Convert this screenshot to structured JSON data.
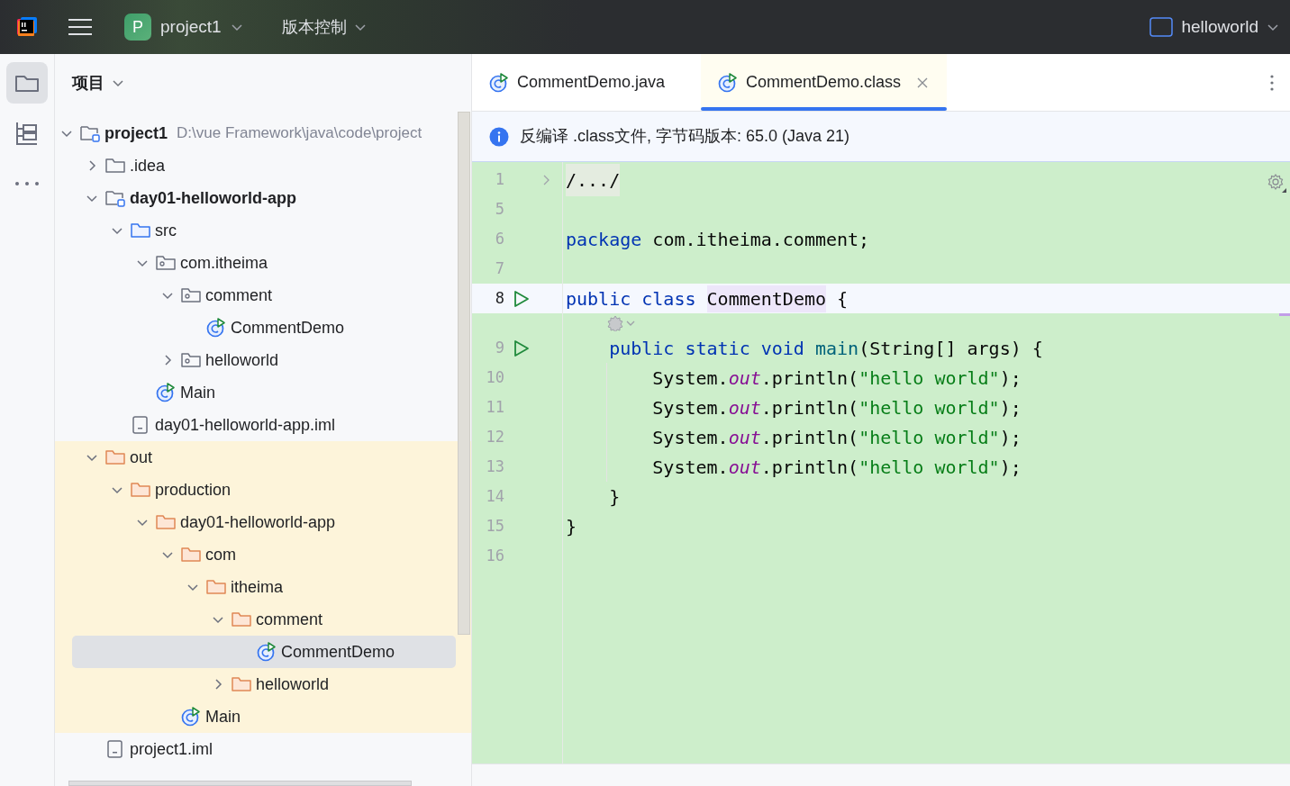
{
  "title_bar": {
    "project_badge": "P",
    "project": "project1",
    "vcs": "版本控制",
    "run_config": "helloworld"
  },
  "tool_strip": [
    {
      "kind": "project",
      "selected": true
    },
    {
      "kind": "structure",
      "selected": false
    },
    {
      "kind": "more",
      "selected": false
    }
  ],
  "project_panel": {
    "title": "项目",
    "tree": [
      {
        "label": "project1",
        "detail": "D:\\vue Framework\\java\\code\\project",
        "kind": "module",
        "expanded": true,
        "selected": false,
        "children": [
          {
            "label": ".idea",
            "kind": "folder",
            "expanded": false,
            "selected": false
          },
          {
            "label": "day01-helloworld-app",
            "kind": "module",
            "expanded": true,
            "selected": false,
            "children": [
              {
                "label": "src",
                "kind": "source-folder",
                "expanded": true,
                "selected": false,
                "children": [
                  {
                    "label": "com.itheima",
                    "kind": "package",
                    "expanded": true,
                    "selected": false,
                    "children": [
                      {
                        "label": "comment",
                        "kind": "package",
                        "expanded": true,
                        "selected": false,
                        "children": [
                          {
                            "label": "CommentDemo",
                            "kind": "class",
                            "selected": false
                          }
                        ]
                      },
                      {
                        "label": "helloworld",
                        "kind": "package",
                        "expanded": false,
                        "selected": false
                      }
                    ]
                  },
                  {
                    "label": "Main",
                    "kind": "class",
                    "selected": false
                  }
                ]
              },
              {
                "label": "day01-helloworld-app.iml",
                "kind": "file",
                "selected": false
              }
            ]
          },
          {
            "label": "out",
            "kind": "output-folder",
            "expanded": true,
            "selected": false,
            "children": [
              {
                "label": "production",
                "kind": "output-folder",
                "expanded": true,
                "selected": false,
                "children": [
                  {
                    "label": "day01-helloworld-app",
                    "kind": "output-folder",
                    "expanded": true,
                    "selected": false,
                    "children": [
                      {
                        "label": "com",
                        "kind": "output-folder",
                        "expanded": true,
                        "selected": false,
                        "children": [
                          {
                            "label": "itheima",
                            "kind": "output-folder",
                            "expanded": true,
                            "selected": false,
                            "children": [
                              {
                                "label": "comment",
                                "kind": "output-folder",
                                "expanded": true,
                                "selected": false,
                                "children": [
                                  {
                                    "label": "CommentDemo",
                                    "kind": "class",
                                    "selected": true
                                  }
                                ]
                              },
                              {
                                "label": "helloworld",
                                "kind": "output-folder",
                                "expanded": false,
                                "selected": false
                              }
                            ]
                          }
                        ]
                      },
                      {
                        "label": "Main",
                        "kind": "class",
                        "selected": false
                      }
                    ]
                  }
                ]
              }
            ]
          },
          {
            "label": "project1.iml",
            "kind": "file",
            "selected": false
          }
        ]
      }
    ]
  },
  "editor": {
    "tabs": [
      {
        "label": "CommentDemo.java",
        "selected": false
      },
      {
        "label": "CommentDemo.class",
        "selected": true
      }
    ],
    "banner": "反编译 .class文件, 字节码版本: 65.0 (Java 21)",
    "lines": [
      {
        "kind": "code",
        "number": "1",
        "run": false,
        "current": false,
        "tokens": [
          {
            "kind": "folded",
            "text": "/.../"
          }
        ]
      },
      {
        "kind": "code",
        "number": "5",
        "run": false,
        "current": false
      },
      {
        "kind": "code",
        "number": "6",
        "run": false,
        "current": false,
        "tokens": [
          {
            "kind": "keyword",
            "text": "package"
          },
          {
            "kind": "plain",
            "text": " com.itheima.comment;"
          }
        ]
      },
      {
        "kind": "code",
        "number": "7",
        "run": false,
        "current": false
      },
      {
        "kind": "code",
        "number": "8",
        "run": true,
        "current": true,
        "tokens": [
          {
            "kind": "keyword",
            "text": "public class "
          },
          {
            "kind": "highlight",
            "text": "CommentDemo"
          },
          {
            "kind": "plain",
            "text": " {"
          }
        ]
      },
      {
        "kind": "inlay"
      },
      {
        "kind": "code",
        "number": "9",
        "run": true,
        "current": false,
        "tokens": [
          {
            "kind": "keyword",
            "text": "    public static void "
          },
          {
            "kind": "method",
            "text": "main"
          },
          {
            "kind": "plain",
            "text": "(String[] args) {"
          }
        ]
      },
      {
        "kind": "code",
        "number": "10",
        "run": false,
        "current": false,
        "tokens": [
          {
            "kind": "plain",
            "text": "        System."
          },
          {
            "kind": "field",
            "text": "out"
          },
          {
            "kind": "plain",
            "text": ".println("
          },
          {
            "kind": "string",
            "text": "\"hello world\""
          },
          {
            "kind": "plain",
            "text": ");"
          }
        ]
      },
      {
        "kind": "code",
        "number": "11",
        "run": false,
        "current": false,
        "tokens": [
          {
            "kind": "plain",
            "text": "        System."
          },
          {
            "kind": "field",
            "text": "out"
          },
          {
            "kind": "plain",
            "text": ".println("
          },
          {
            "kind": "string",
            "text": "\"hello world\""
          },
          {
            "kind": "plain",
            "text": ");"
          }
        ]
      },
      {
        "kind": "code",
        "number": "12",
        "run": false,
        "current": false,
        "tokens": [
          {
            "kind": "plain",
            "text": "        System."
          },
          {
            "kind": "field",
            "text": "out"
          },
          {
            "kind": "plain",
            "text": ".println("
          },
          {
            "kind": "string",
            "text": "\"hello world\""
          },
          {
            "kind": "plain",
            "text": ");"
          }
        ]
      },
      {
        "kind": "code",
        "number": "13",
        "run": false,
        "current": false,
        "tokens": [
          {
            "kind": "plain",
            "text": "        System."
          },
          {
            "kind": "field",
            "text": "out"
          },
          {
            "kind": "plain",
            "text": ".println("
          },
          {
            "kind": "string",
            "text": "\"hello world\""
          },
          {
            "kind": "plain",
            "text": ");"
          }
        ]
      },
      {
        "kind": "code",
        "number": "14",
        "run": false,
        "current": false,
        "tokens": [
          {
            "kind": "plain",
            "text": "    }"
          }
        ]
      },
      {
        "kind": "code",
        "number": "15",
        "run": false,
        "current": false,
        "tokens": [
          {
            "kind": "plain",
            "text": "}"
          }
        ]
      },
      {
        "kind": "code",
        "number": "16",
        "run": false,
        "current": false
      }
    ]
  }
}
